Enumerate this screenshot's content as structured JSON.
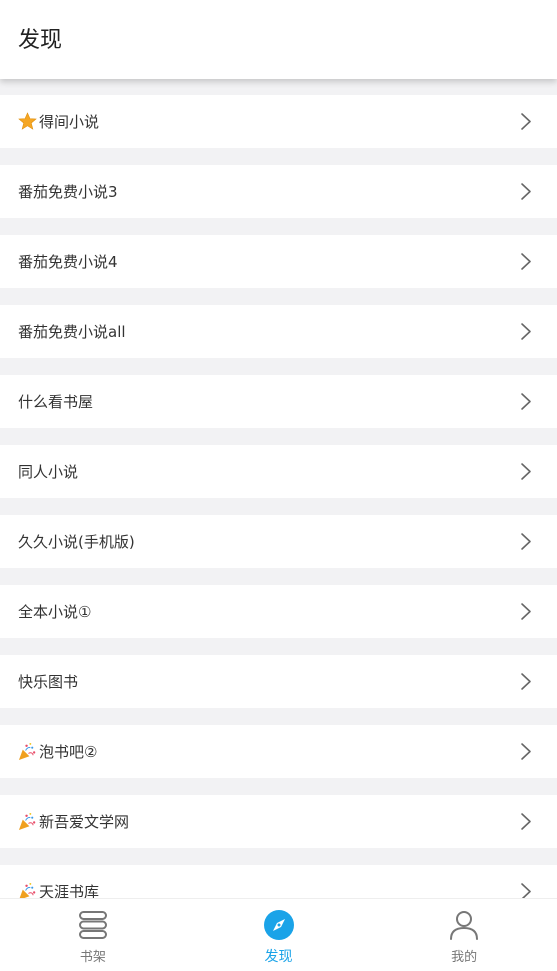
{
  "header": {
    "title": "发现"
  },
  "sources": [
    {
      "label": "得间小说",
      "icon": "star"
    },
    {
      "label": "番茄免费小说3",
      "icon": ""
    },
    {
      "label": "番茄免费小说4",
      "icon": ""
    },
    {
      "label": "番茄免费小说all",
      "icon": ""
    },
    {
      "label": "什么看书屋",
      "icon": ""
    },
    {
      "label": "同人小说",
      "icon": ""
    },
    {
      "label": "久久小说(手机版)",
      "icon": ""
    },
    {
      "label": "全本小说①",
      "icon": ""
    },
    {
      "label": "快乐图书",
      "icon": ""
    },
    {
      "label": "泡书吧②",
      "icon": "party-popper"
    },
    {
      "label": " 新吾爱文学网",
      "icon": "party-popper"
    },
    {
      "label": " 天涯书库",
      "icon": "party-popper"
    }
  ],
  "tabs": [
    {
      "label": "书架",
      "icon": "bookshelf",
      "active": false
    },
    {
      "label": "发现",
      "icon": "compass",
      "active": true
    },
    {
      "label": "我的",
      "icon": "user",
      "active": false
    }
  ],
  "colors": {
    "accent": "#1aa3e8",
    "background": "#f2f2f4",
    "inactive": "#777777"
  }
}
